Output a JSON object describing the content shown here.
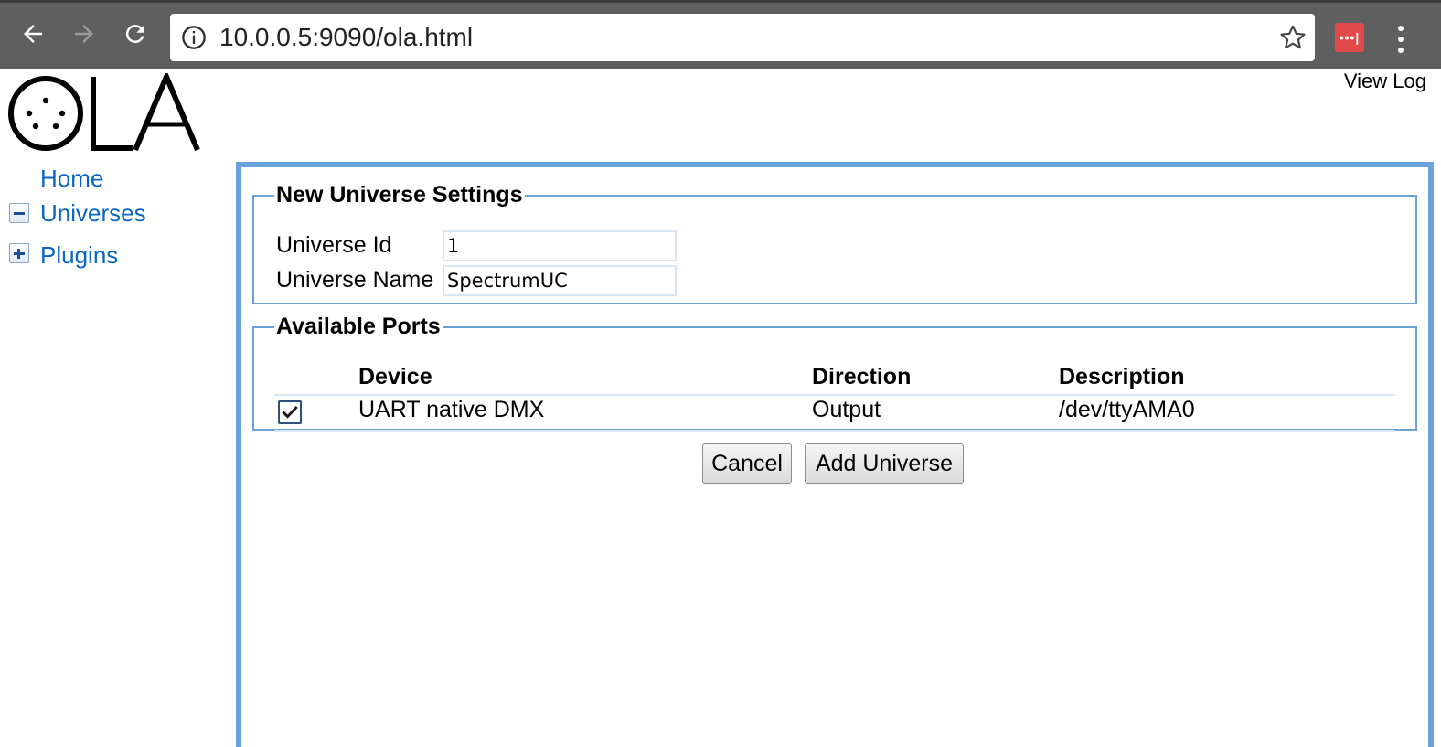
{
  "browser": {
    "url": "10.0.0.5:9090/ola.html",
    "extension_label": "•••|",
    "icons": {
      "back": "arrow-left-icon",
      "forward": "arrow-right-icon",
      "reload": "reload-icon",
      "info": "info-icon",
      "bookmark": "star-icon",
      "menu": "kebab-menu-icon"
    }
  },
  "header": {
    "logo_text": "OLA",
    "view_log": "View Log"
  },
  "sidebar": {
    "items": [
      {
        "label": "Home",
        "toggle": "none"
      },
      {
        "label": "Universes",
        "toggle": "minus"
      },
      {
        "label": "Plugins",
        "toggle": "plus"
      }
    ]
  },
  "settings": {
    "legend": "New Universe Settings",
    "universe_id_label": "Universe Id",
    "universe_id_value": "1",
    "universe_name_label": "Universe Name",
    "universe_name_value": "SpectrumUC"
  },
  "ports": {
    "legend": "Available Ports",
    "columns": [
      "Device",
      "Direction",
      "Description"
    ],
    "rows": [
      {
        "checked": true,
        "device": "UART native DMX",
        "direction": "Output",
        "description": "/dev/ttyAMA0"
      }
    ]
  },
  "actions": {
    "cancel": "Cancel",
    "add": "Add Universe"
  },
  "colors": {
    "accent": "#6aa3dc",
    "link": "#0a66c2",
    "chrome": "#5f5f5f"
  }
}
